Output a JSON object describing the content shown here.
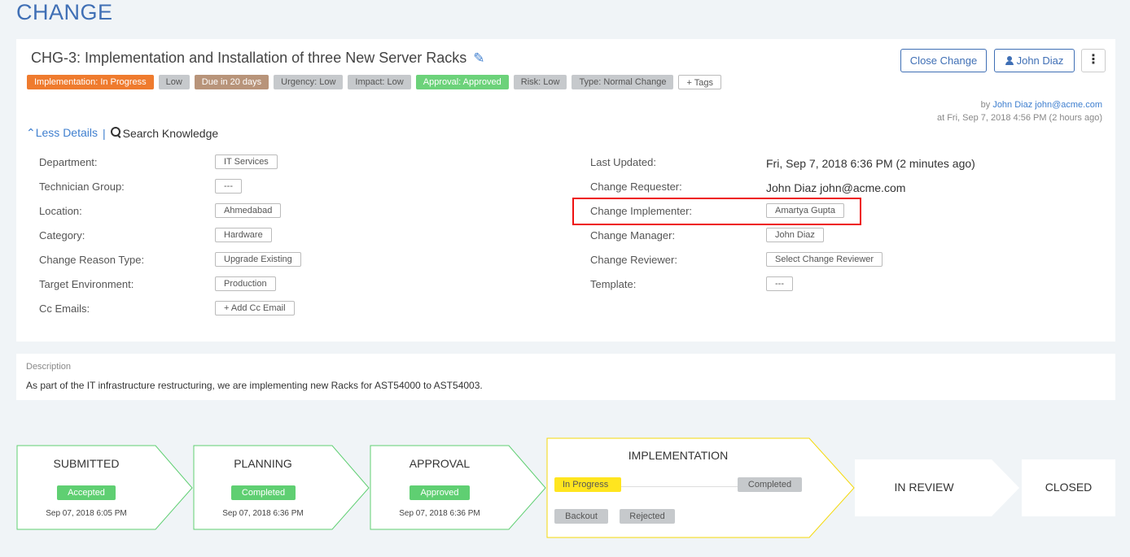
{
  "page_title": "CHANGE",
  "change": {
    "title": "CHG-3: Implementation and Installation of three New Server Racks",
    "tags": [
      {
        "label": "Implementation: In Progress",
        "style": "orange"
      },
      {
        "label": "Low",
        "style": "grey"
      },
      {
        "label": "Due in 20 days",
        "style": "brown"
      },
      {
        "label": "Urgency: Low",
        "style": "grey"
      },
      {
        "label": "Impact: Low",
        "style": "grey"
      },
      {
        "label": "Approval: Approved",
        "style": "green"
      },
      {
        "label": "Risk: Low",
        "style": "grey"
      },
      {
        "label": "Type: Normal Change",
        "style": "grey"
      },
      {
        "label": "+ Tags",
        "style": "outline"
      }
    ],
    "close_label": "Close Change",
    "user_label": "John Diaz",
    "more_label": "⋮",
    "byline": {
      "prefix": "by",
      "name": "John Diaz",
      "email": "john@acme.com",
      "time": "at Fri, Sep 7, 2018 4:56 PM (2 hours ago)"
    },
    "less_details": "Less Details",
    "separator": "|",
    "search_knowledge": "Search Knowledge",
    "left_fields": [
      {
        "label": "Department:",
        "value": "IT Services"
      },
      {
        "label": "Technician Group:",
        "value": "---"
      },
      {
        "label": "Location:",
        "value": "Ahmedabad"
      },
      {
        "label": "Category:",
        "value": "Hardware"
      },
      {
        "label": "Change Reason Type:",
        "value": "Upgrade Existing"
      },
      {
        "label": "Target Environment:",
        "value": "Production"
      },
      {
        "label": "Cc Emails:",
        "value": "+ Add Cc Email"
      }
    ],
    "right_fields": [
      {
        "label": "Last Updated:",
        "value": "Fri, Sep 7, 2018 6:36 PM (2 minutes ago)"
      },
      {
        "label": "Change Requester:",
        "value": "John Diaz john@acme.com"
      },
      {
        "label": "Change Implementer:",
        "value": "Amartya Gupta"
      },
      {
        "label": "Change Manager:",
        "value": "John Diaz"
      },
      {
        "label": "Change Reviewer:",
        "value": "Select Change Reviewer"
      },
      {
        "label": "Template:",
        "value": "---"
      }
    ]
  },
  "description": {
    "label": "Description",
    "text": "As part of the IT infrastructure restructuring, we are implementing new Racks for AST54000 to AST54003."
  },
  "stages": {
    "submitted": {
      "title": "SUBMITTED",
      "badge": "Accepted",
      "date": "Sep 07, 2018 6:05 PM"
    },
    "planning": {
      "title": "PLANNING",
      "badge": "Completed",
      "date": "Sep 07, 2018 6:36 PM"
    },
    "approval": {
      "title": "APPROVAL",
      "badge": "Approved",
      "date": "Sep 07, 2018 6:36 PM"
    },
    "implementation": {
      "title": "IMPLEMENTATION",
      "in_progress": "In Progress",
      "completed": "Completed",
      "backout": "Backout",
      "rejected": "Rejected"
    },
    "in_review": {
      "title": "IN REVIEW"
    },
    "closed": {
      "title": "CLOSED"
    }
  },
  "colors": {
    "accent": "#3f6fb5",
    "stage_done": "#5fcf72",
    "stage_current": "#f5d90a",
    "highlight": "#ee1111"
  }
}
